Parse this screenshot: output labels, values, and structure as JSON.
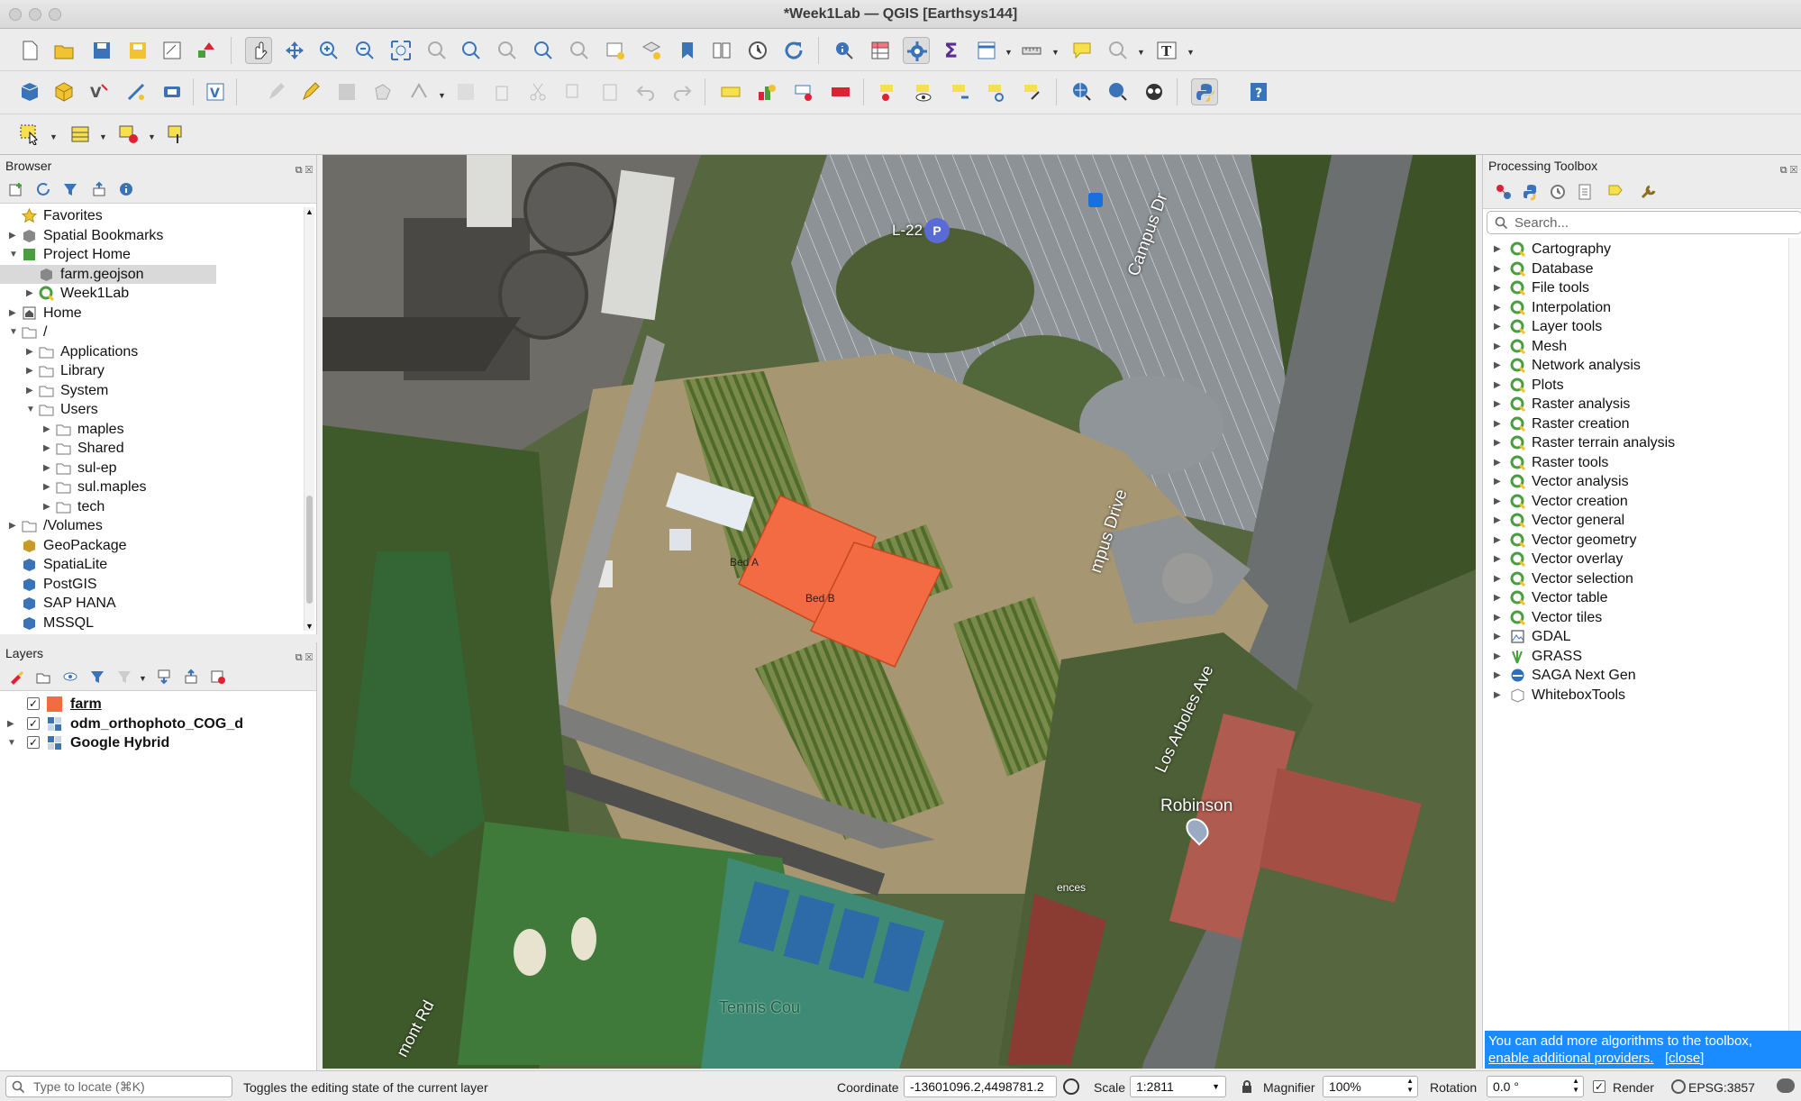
{
  "window": {
    "title": "*Week1Lab — QGIS [Earthsys144]"
  },
  "browser": {
    "title": "Browser",
    "items": [
      {
        "label": "Favorites",
        "icon": "star-icon",
        "level": 0,
        "expander": "none"
      },
      {
        "label": "Spatial Bookmarks",
        "icon": "bookmarks-icon",
        "level": 0,
        "expander": "collapsed"
      },
      {
        "label": "Project Home",
        "icon": "project-home-icon",
        "level": 0,
        "expander": "expanded"
      },
      {
        "label": "farm.geojson",
        "icon": "polygon-layer-icon",
        "level": 1,
        "expander": "none",
        "selected": true
      },
      {
        "label": "Week1Lab",
        "icon": "qgis-icon",
        "level": 1,
        "expander": "collapsed"
      },
      {
        "label": "Home",
        "icon": "home-icon",
        "level": 0,
        "expander": "collapsed"
      },
      {
        "label": "/",
        "icon": "folder-icon",
        "level": 0,
        "expander": "expanded"
      },
      {
        "label": "Applications",
        "icon": "folder-icon",
        "level": 1,
        "expander": "collapsed"
      },
      {
        "label": "Library",
        "icon": "folder-icon",
        "level": 1,
        "expander": "collapsed"
      },
      {
        "label": "System",
        "icon": "folder-icon",
        "level": 1,
        "expander": "collapsed"
      },
      {
        "label": "Users",
        "icon": "folder-icon",
        "level": 1,
        "expander": "expanded"
      },
      {
        "label": "maples",
        "icon": "home-folder-icon",
        "level": 2,
        "expander": "collapsed"
      },
      {
        "label": "Shared",
        "icon": "folder-icon",
        "level": 2,
        "expander": "collapsed"
      },
      {
        "label": "sul-ep",
        "icon": "folder-icon",
        "level": 2,
        "expander": "collapsed"
      },
      {
        "label": "sul.maples",
        "icon": "folder-icon",
        "level": 2,
        "expander": "collapsed"
      },
      {
        "label": "tech",
        "icon": "folder-icon",
        "level": 2,
        "expander": "collapsed"
      },
      {
        "label": "/Volumes",
        "icon": "folder-icon",
        "level": 0,
        "expander": "collapsed"
      },
      {
        "label": "GeoPackage",
        "icon": "geopackage-icon",
        "level": 0,
        "expander": "none"
      },
      {
        "label": "SpatiaLite",
        "icon": "spatialite-icon",
        "level": 0,
        "expander": "none"
      },
      {
        "label": "PostGIS",
        "icon": "postgis-icon",
        "level": 0,
        "expander": "none"
      },
      {
        "label": "SAP HANA",
        "icon": "sap-hana-icon",
        "level": 0,
        "expander": "none"
      },
      {
        "label": "MSSQL",
        "icon": "mssql-icon",
        "level": 0,
        "expander": "none"
      }
    ]
  },
  "layers": {
    "title": "Layers",
    "items": [
      {
        "label": "farm",
        "icon": "polygon-swatch-icon",
        "checked": true,
        "expander": "none",
        "color": "#f26b43"
      },
      {
        "label": "odm_orthophoto_COG_d",
        "icon": "raster-icon",
        "checked": true,
        "expander": "collapsed"
      },
      {
        "label": "Google Hybrid",
        "icon": "raster-icon",
        "checked": true,
        "expander": "expanded"
      }
    ]
  },
  "map": {
    "labels": {
      "bed_a": "Bed A",
      "bed_b": "Bed B",
      "parking": "L-22",
      "road_campus_dr": "Campus Dr",
      "road_campus_drive": "mpus Drive",
      "road_los_arboles": "Los Arboles Ave",
      "robinson": "Robinson",
      "tennis": "Tennis Cou",
      "road_mont": "mont Rd",
      "ences": "ences"
    },
    "bed_color": "#f26b43"
  },
  "toolbox": {
    "title": "Processing Toolbox",
    "search_placeholder": "Search...",
    "items": [
      {
        "label": "Cartography",
        "icon": "qgis-icon"
      },
      {
        "label": "Database",
        "icon": "qgis-icon"
      },
      {
        "label": "File tools",
        "icon": "qgis-icon"
      },
      {
        "label": "Interpolation",
        "icon": "qgis-icon"
      },
      {
        "label": "Layer tools",
        "icon": "qgis-icon"
      },
      {
        "label": "Mesh",
        "icon": "qgis-icon"
      },
      {
        "label": "Network analysis",
        "icon": "qgis-icon"
      },
      {
        "label": "Plots",
        "icon": "qgis-icon"
      },
      {
        "label": "Raster analysis",
        "icon": "qgis-icon"
      },
      {
        "label": "Raster creation",
        "icon": "qgis-icon"
      },
      {
        "label": "Raster terrain analysis",
        "icon": "qgis-icon"
      },
      {
        "label": "Raster tools",
        "icon": "qgis-icon"
      },
      {
        "label": "Vector analysis",
        "icon": "qgis-icon"
      },
      {
        "label": "Vector creation",
        "icon": "qgis-icon"
      },
      {
        "label": "Vector general",
        "icon": "qgis-icon"
      },
      {
        "label": "Vector geometry",
        "icon": "qgis-icon"
      },
      {
        "label": "Vector overlay",
        "icon": "qgis-icon"
      },
      {
        "label": "Vector selection",
        "icon": "qgis-icon"
      },
      {
        "label": "Vector table",
        "icon": "qgis-icon"
      },
      {
        "label": "Vector tiles",
        "icon": "qgis-icon"
      },
      {
        "label": "GDAL",
        "icon": "gdal-icon"
      },
      {
        "label": "GRASS",
        "icon": "grass-icon"
      },
      {
        "label": "SAGA Next Gen",
        "icon": "saga-icon"
      },
      {
        "label": "WhiteboxTools",
        "icon": "whitebox-icon"
      }
    ],
    "info_text": "You can add more algorithms to the toolbox,",
    "info_link": "enable additional providers.",
    "info_close": "[close]"
  },
  "statusbar": {
    "locate_placeholder": "Type to locate (⌘K)",
    "message": "Toggles the editing state of the current layer",
    "coordinate_label": "Coordinate",
    "coordinate_value": "-13601096.2,4498781.2",
    "scale_label": "Scale",
    "scale_value": "1:2811",
    "magnifier_label": "Magnifier",
    "magnifier_value": "100%",
    "rotation_label": "Rotation",
    "rotation_value": "0.0 °",
    "render_label": "Render",
    "render_checked": true,
    "crs": "EPSG:3857"
  }
}
